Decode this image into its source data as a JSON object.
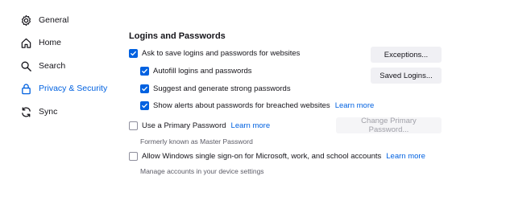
{
  "sidebar": {
    "items": [
      {
        "label": "General",
        "icon": "gear-icon",
        "active": false
      },
      {
        "label": "Home",
        "icon": "home-icon",
        "active": false
      },
      {
        "label": "Search",
        "icon": "search-icon",
        "active": false
      },
      {
        "label": "Privacy & Security",
        "icon": "lock-icon",
        "active": true
      },
      {
        "label": "Sync",
        "icon": "sync-icon",
        "active": false
      }
    ]
  },
  "logins": {
    "title": "Logins and Passwords",
    "ask_save": {
      "label": "Ask to save logins and passwords for websites",
      "checked": true
    },
    "autofill": {
      "label": "Autofill logins and passwords",
      "checked": true
    },
    "suggest": {
      "label": "Suggest and generate strong passwords",
      "checked": true
    },
    "alerts": {
      "label": "Show alerts about passwords for breached websites",
      "checked": true,
      "link": "Learn more"
    },
    "primary": {
      "label": "Use a Primary Password",
      "checked": false,
      "link": "Learn more",
      "note": "Formerly known as Master Password"
    },
    "windows_sso": {
      "label": "Allow Windows single sign-on for Microsoft, work, and school accounts",
      "checked": false,
      "link": "Learn more",
      "note": "Manage accounts in your device settings"
    },
    "buttons": {
      "exceptions": "Exceptions...",
      "saved_logins": "Saved Logins...",
      "change_primary": "Change Primary Password..."
    }
  },
  "colors": {
    "accent": "#0061e0",
    "text": "#15141a",
    "muted": "#5b5b66"
  }
}
